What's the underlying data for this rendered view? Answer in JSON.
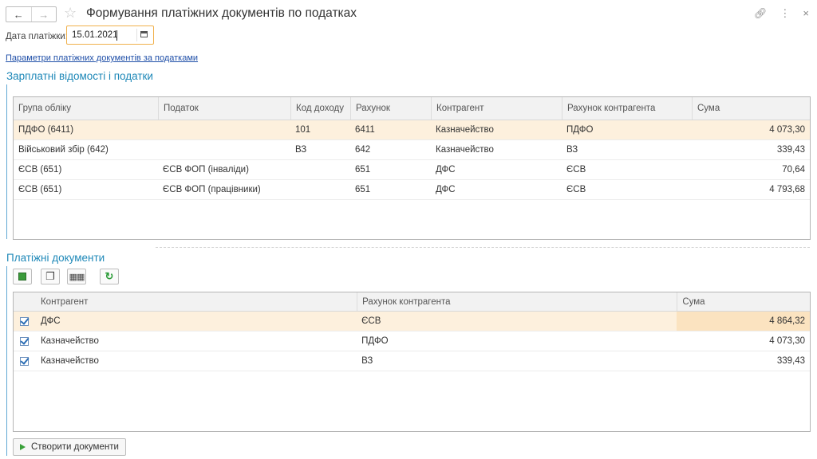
{
  "window": {
    "title": "Формування платіжних документів по податках",
    "icons": [
      "back-arrow-icon",
      "forward-arrow-icon",
      "star-icon",
      "link-icon",
      "more-icon",
      "close-icon"
    ]
  },
  "date_field": {
    "label": "Дата платіжки:",
    "value": "15.01.2021"
  },
  "params_link": "Параметри платіжних документів за податками",
  "payroll_section": {
    "title": "Зарплатні відомості і податки",
    "columns": [
      "Група обліку",
      "Податок",
      "Код доходу",
      "Рахунок",
      "Контрагент",
      "Рахунок контрагента",
      "Сума"
    ],
    "rows": [
      {
        "group": "ПДФО (6411)",
        "tax": "",
        "code": "101",
        "account": "6411",
        "counterparty": "Казначейство",
        "cp_account": "ПДФО",
        "sum": "4 073,30"
      },
      {
        "group": "Військовий збір (642)",
        "tax": "",
        "code": "ВЗ",
        "account": "642",
        "counterparty": "Казначейство",
        "cp_account": "ВЗ",
        "sum": "339,43"
      },
      {
        "group": "ЄСВ (651)",
        "tax": "ЄСВ ФОП (інваліди)",
        "code": "",
        "account": "651",
        "counterparty": "ДФС",
        "cp_account": "ЄСВ",
        "sum": "70,64"
      },
      {
        "group": "ЄСВ (651)",
        "tax": "ЄСВ ФОП (працівники)",
        "code": "",
        "account": "651",
        "counterparty": "ДФС",
        "cp_account": "ЄСВ",
        "sum": "4 793,68"
      }
    ]
  },
  "payments_section": {
    "title": "Платіжні документи",
    "toolbar_icons": [
      "check-all-icon",
      "copy-icon",
      "toggle-icon",
      "refresh-icon"
    ],
    "columns": [
      "Контрагент",
      "Рахунок контрагента",
      "Сума"
    ],
    "rows": [
      {
        "checked": true,
        "counterparty": "ДФС",
        "cp_account": "ЄСВ",
        "sum": "4 864,32"
      },
      {
        "checked": true,
        "counterparty": "Казначейство",
        "cp_account": "ПДФО",
        "sum": "4 073,30"
      },
      {
        "checked": true,
        "counterparty": "Казначейство",
        "cp_account": "ВЗ",
        "sum": "339,43"
      }
    ]
  },
  "create_button": "Створити документи",
  "colors": {
    "accent_blue": "#1e88b8",
    "selected_row": "#fdf0dd",
    "focus_orange": "#f0b14d",
    "link": "#1f4fa8"
  }
}
